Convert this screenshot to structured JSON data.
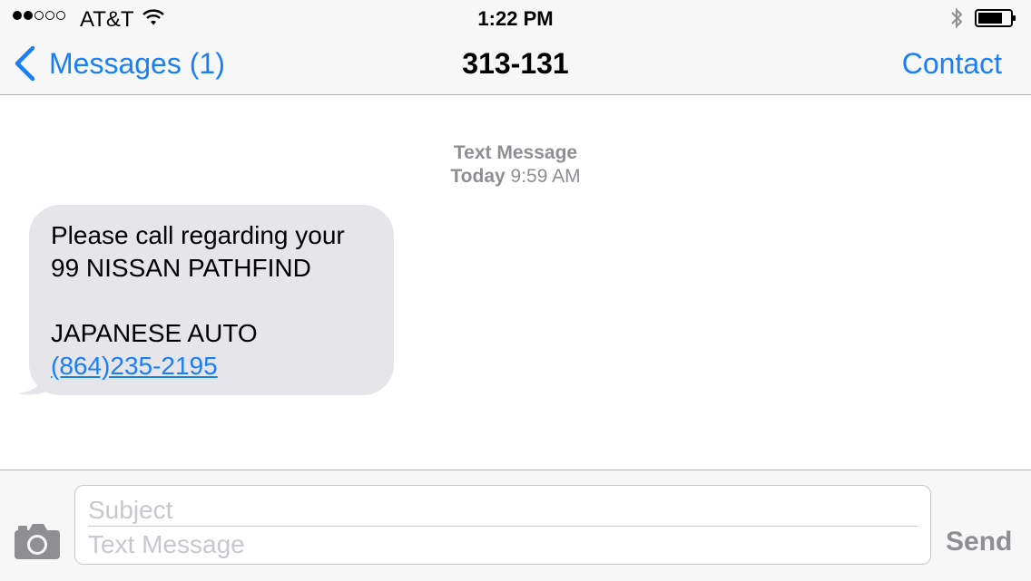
{
  "status_bar": {
    "signal_bars_filled": 2,
    "signal_bars_total": 5,
    "carrier": "AT&T",
    "time": "1:22 PM",
    "wifi_icon": "wifi-icon",
    "bluetooth_icon": "bluetooth-icon",
    "battery_icon": "battery-icon"
  },
  "nav": {
    "back_label": "Messages (1)",
    "title": "313-131",
    "contact_label": "Contact"
  },
  "conversation": {
    "timestamp_label": "Text Message",
    "timestamp_day": "Today",
    "timestamp_time": "9:59 AM",
    "message": {
      "line1": "Please call regarding your",
      "line2": "99 NISSAN PATHFIND",
      "line3": "JAPANESE AUTO",
      "phone": "(864)235-2195"
    }
  },
  "compose": {
    "camera_icon": "camera-icon",
    "subject_placeholder": "Subject",
    "message_placeholder": "Text Message",
    "send_label": "Send"
  },
  "colors": {
    "accent": "#1a7ff6",
    "bubble_received": "#e5e5ea",
    "muted_text": "#8e8e93",
    "bar_background": "#f7f7f8"
  }
}
